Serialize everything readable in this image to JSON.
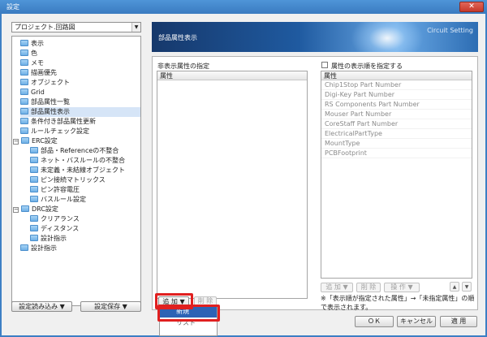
{
  "window": {
    "title": "設定",
    "close_label": "✕"
  },
  "left": {
    "combo_value": "プロジェクト.回路図",
    "tree": [
      {
        "label": "表示",
        "indent": 0
      },
      {
        "label": "色",
        "indent": 0
      },
      {
        "label": "メモ",
        "indent": 0
      },
      {
        "label": "描画優先",
        "indent": 0
      },
      {
        "label": "オブジェクト",
        "indent": 0
      },
      {
        "label": "Grid",
        "indent": 0
      },
      {
        "label": "部品属性一覧",
        "indent": 0
      },
      {
        "label": "部品属性表示",
        "indent": 0,
        "selected": true
      },
      {
        "label": "条件付き部品属性更新",
        "indent": 0
      },
      {
        "label": "ルールチェック設定",
        "indent": 0
      },
      {
        "label": "ERC設定",
        "indent": 0,
        "expander": "−"
      },
      {
        "label": "部品・Referenceの不整合",
        "indent": 1
      },
      {
        "label": "ネット・バスルールの不整合",
        "indent": 1
      },
      {
        "label": "未定義・未結線オブジェクト",
        "indent": 1
      },
      {
        "label": "ピン接続マトリックス",
        "indent": 1
      },
      {
        "label": "ピン許容電圧",
        "indent": 1
      },
      {
        "label": "バスルール設定",
        "indent": 1
      },
      {
        "label": "DRC設定",
        "indent": 0,
        "expander": "−"
      },
      {
        "label": "クリアランス",
        "indent": 1
      },
      {
        "label": "ディスタンス",
        "indent": 1
      },
      {
        "label": "設計指示",
        "indent": 1
      },
      {
        "label": "設計指示",
        "indent": 0
      }
    ],
    "load_button": "設定読み込み ▼",
    "save_button": "設定保存 ▼"
  },
  "header": {
    "title": "部品属性表示",
    "subtitle": "Circuit Setting"
  },
  "hidden_attrs": {
    "label": "非表示属性の指定",
    "column": "属性",
    "add_button": "追 加 ▼",
    "delete_button": "削 除",
    "menu": [
      "新規",
      "リスト"
    ]
  },
  "display_order": {
    "checkbox_label": "属性の表示順を指定する",
    "column": "属性",
    "items": [
      "Chip1Stop Part Number",
      "Digi-Key Part Number",
      "RS Components Part Number",
      "Mouser Part Number",
      "CoreStaff Part Number",
      "ElectricalPartType",
      "MountType",
      "PCBFootprint"
    ],
    "add_button": "追 加 ▼",
    "delete_button": "削 除",
    "operation_button": "操 作 ▼",
    "up_icon": "▲",
    "down_icon": "▼",
    "note": "※「表示順が指定された属性」→「未指定属性」の順で表示されます。"
  },
  "footer": {
    "ok": "ＯＫ",
    "cancel": "キャンセル",
    "apply": "適 用"
  },
  "colors": {
    "highlight": "#e02020",
    "selection": "#2d63b5"
  }
}
